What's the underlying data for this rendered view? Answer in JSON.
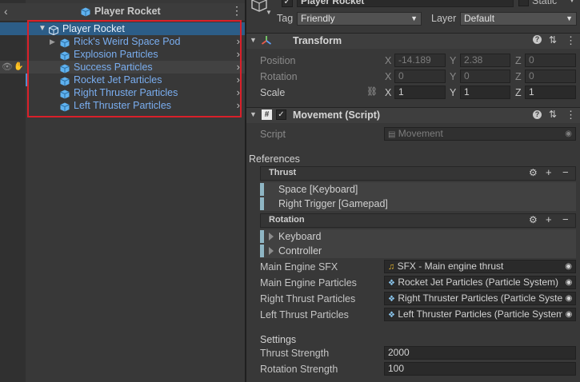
{
  "hierarchy": {
    "scene_title": "Player Rocket",
    "root": "Player Rocket",
    "children": [
      "Rick's Weird Space Pod",
      "Explosion Particles",
      "Success Particles",
      "Rocket Jet Particles",
      "Right Thruster Particles",
      "Left Thruster Particles"
    ]
  },
  "inspector": {
    "object_name": "Player Rocket",
    "static_label": "Static",
    "tag_label": "Tag",
    "tag_value": "Friendly",
    "layer_label": "Layer",
    "layer_value": "Default",
    "transform": {
      "title": "Transform",
      "position_label": "Position",
      "rotation_label": "Rotation",
      "scale_label": "Scale",
      "axis_x": "X",
      "axis_y": "Y",
      "axis_z": "Z",
      "position": [
        "-14.189",
        "2.38",
        "0"
      ],
      "rotation": [
        "0",
        "0",
        "0"
      ],
      "scale": [
        "1",
        "1",
        "1"
      ]
    },
    "movement": {
      "title": "Movement (Script)",
      "script_label": "Script",
      "script_value": "Movement",
      "references_label": "References",
      "thrust_title": "Thrust",
      "thrust_bindings": [
        "Space [Keyboard]",
        "Right Trigger [Gamepad]"
      ],
      "rotation_title": "Rotation",
      "rotation_bindings": [
        "Keyboard",
        "Controller"
      ],
      "main_engine_sfx_label": "Main Engine SFX",
      "main_engine_sfx_value": "SFX - Main engine thrust",
      "main_engine_particles_label": "Main Engine Particles",
      "main_engine_particles_value": "Rocket Jet Particles (Particle System)",
      "right_thrust_particles_label": "Right Thrust Particles",
      "right_thrust_particles_value": "Right Thruster Particles (Particle System)",
      "left_thrust_particles_label": "Left Thrust Particles",
      "left_thrust_particles_value": "Left Thruster Particles (Particle System)",
      "settings_label": "Settings",
      "thrust_strength_label": "Thrust Strength",
      "thrust_strength_value": "2000",
      "rotation_strength_label": "Rotation Strength",
      "rotation_strength_value": "100"
    }
  },
  "colors": {
    "selection": "#2c5d87",
    "hierarchy_text": "#7aaef0",
    "highlight_box": "#d9202a",
    "prefab_cube": "#5fb2f0"
  }
}
